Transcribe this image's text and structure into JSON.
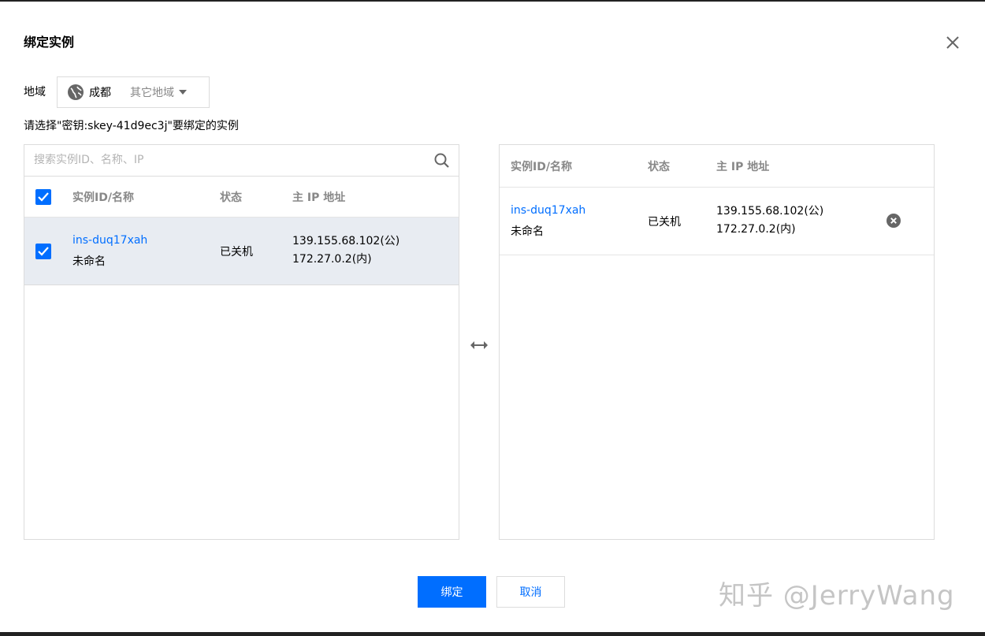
{
  "dialog": {
    "title": "绑定实例"
  },
  "region": {
    "label": "地域",
    "current": "成都",
    "other": "其它地域"
  },
  "hint": "请选择\"密钥:skey-41d9ec3j\"要绑定的实例",
  "left_panel": {
    "search_placeholder": "搜索实例ID、名称、IP",
    "columns": [
      "实例ID/名称",
      "状态",
      "主 IP 地址"
    ],
    "rows": [
      {
        "id": "ins-duq17xah",
        "name": "未命名",
        "status": "已关机",
        "ip_public": "139.155.68.102(公)",
        "ip_private": "172.27.0.2(内)",
        "checked": true
      }
    ]
  },
  "right_panel": {
    "columns": [
      "实例ID/名称",
      "状态",
      "主 IP 地址"
    ],
    "rows": [
      {
        "id": "ins-duq17xah",
        "name": "未命名",
        "status": "已关机",
        "ip_public": "139.155.68.102(公)",
        "ip_private": "172.27.0.2(内)"
      }
    ]
  },
  "buttons": {
    "confirm": "绑定",
    "cancel": "取消"
  },
  "watermark": "知乎 @JerryWang",
  "colors": {
    "accent": "#006eff",
    "selected_row": "#e8ecf2",
    "border": "#dcdcdc"
  }
}
